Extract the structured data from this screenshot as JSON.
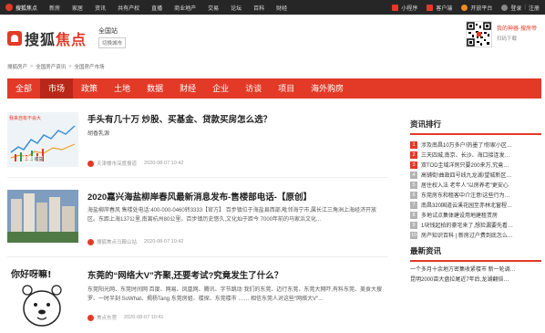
{
  "topbar": {
    "nav": [
      "搜狐焦点",
      "新房",
      "家居",
      "资讯",
      "共有产权",
      "直播",
      "商业地产",
      "交易",
      "论坛",
      "百科",
      "财经"
    ],
    "right": {
      "mini_program": "小程序",
      "client": "客户端",
      "open_platform": "开放平台",
      "login": "登录",
      "register": "注册"
    }
  },
  "header": {
    "brand_a": "搜狐",
    "brand_b": "焦点",
    "city": "全国站",
    "switch_city": "切换城市",
    "qr_line1": "我的神器·搜房帝",
    "qr_line2": "扫码下载"
  },
  "breadcrumb": [
    "搜狐房产",
    "全国房产资讯",
    "全国房产市场"
  ],
  "channels": [
    "全部",
    "市场",
    "政策",
    "土地",
    "数据",
    "财经",
    "企业",
    "访谈",
    "项目",
    "海外购房"
  ],
  "articles": [
    {
      "title": "手头有几十万 炒股、买基金、贷款买房怎么选？",
      "snippet": "胡香乳源",
      "source": "天津楼市深度报道",
      "date": "2020-08-07 10:42",
      "thumb_label_1": "我来自有不会大",
      "thumb_label_2": "…… 收益"
    },
    {
      "title": "2020嘉兴海盐柳岸春风最新消息发布-售楼部电话-【原创】",
      "snippet": "海盐柳岸春风 售楼处电话:400-000-0460转3333【官方】 百步镇位于海盐县西部,毗邻海宁市,属长江三角洲上海经济开放区。东距上海137公里,南离杭州80公里。百步镇历史悠久,文化灿于距今 7000年前的马家浜文化...",
      "source": "搜狐焦点马鞍山站",
      "date": "2020-08-07 10:42"
    },
    {
      "title": "东莞的“网络大V”齐聚,还要考试?究竟发生了什么？",
      "snippet": "东莞阳光网、东莞时间网 百度、网易、凤凰网、腾讯、字节跳动 我们的东莞、迈行东莞、东莞大网吓,有料东莞、美食大搜罗、一时半刻 SoWhat、揭杨Tang 东莞房姐、楼探、东莞楼市 …… 相信东莞人对这些\"网络大V\"...",
      "source": "焦点东莞",
      "date": "2020-08-07 10:41",
      "thumb_text": "你好呀嘛!"
    }
  ],
  "sidebar": {
    "rank_title": "资讯排行",
    "rank_items": [
      {
        "num": "1",
        "text": "涉及南昌10万多户!热墨了!你家小区…"
      },
      {
        "num": "2",
        "text": "三天四城,南京、长沙、海口接连发…"
      },
      {
        "num": "3",
        "text": "双TOD圭域洋房只要200来万,究竟…"
      },
      {
        "num": "4",
        "text": "高铺街!曲政四号线九龙湖/望城新区…"
      },
      {
        "num": "5",
        "text": "居住权入法 老年人\"以房养老\"更安心"
      },
      {
        "num": "6",
        "text": "东莞房东和租客中介注意!这些行为…"
      },
      {
        "num": "7",
        "text": "南昌320国道云溪花园至赤林北窗程…"
      },
      {
        "num": "8",
        "text": "多地试点集体建设用地建租赁房"
      },
      {
        "num": "9",
        "text": "1块钱起拍的豪宅来了,想捡漏要先看…"
      },
      {
        "num": "10",
        "text": "房产知识百科 | 新房过户费到底怎么…"
      }
    ],
    "latest_title": "最新资讯",
    "latest_items": [
      "一个多月十余地方密集收紧楼市 新一轮调…",
      "昆明2000亩大盘拉尾近7年后,龙湖翻倍…"
    ]
  },
  "colors": {
    "accent": "#e23a27",
    "topbar_bg": "#262626",
    "active_channel": "#b8281a"
  }
}
